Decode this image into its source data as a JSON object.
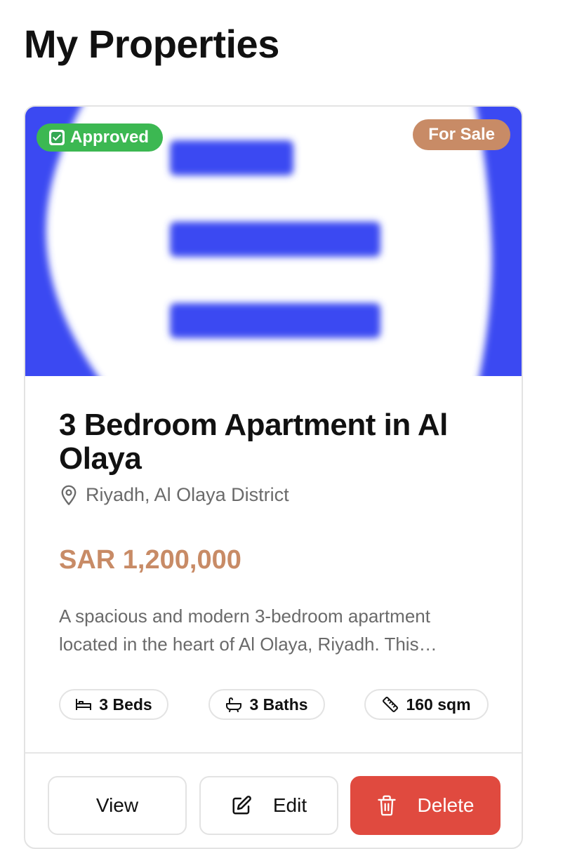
{
  "page": {
    "title": "My Properties"
  },
  "property": {
    "status_badge": "Approved",
    "listing_badge": "For Sale",
    "title": "3 Bedroom Apartment in Al Olaya",
    "location": "Riyadh, Al Olaya District",
    "price": "SAR 1,200,000",
    "description": "A spacious and modern 3-bedroom apartment located in the heart of Al Olaya, Riyadh. This…",
    "features": {
      "beds": "3 Beds",
      "baths": "3 Baths",
      "area": "160 sqm"
    },
    "actions": {
      "view": "View",
      "edit": "Edit",
      "delete": "Delete"
    }
  },
  "colors": {
    "approved": "#3cb852",
    "accent": "#c88b66",
    "danger": "#e04a3f",
    "placeholder_blue": "#3a48f2"
  },
  "icons": {
    "status": "check-box-icon",
    "location": "map-pin-icon",
    "beds": "bed-icon",
    "baths": "bath-icon",
    "area": "ruler-icon",
    "edit": "edit-icon",
    "delete": "trash-icon",
    "image_placeholder": "document-list-icon"
  }
}
